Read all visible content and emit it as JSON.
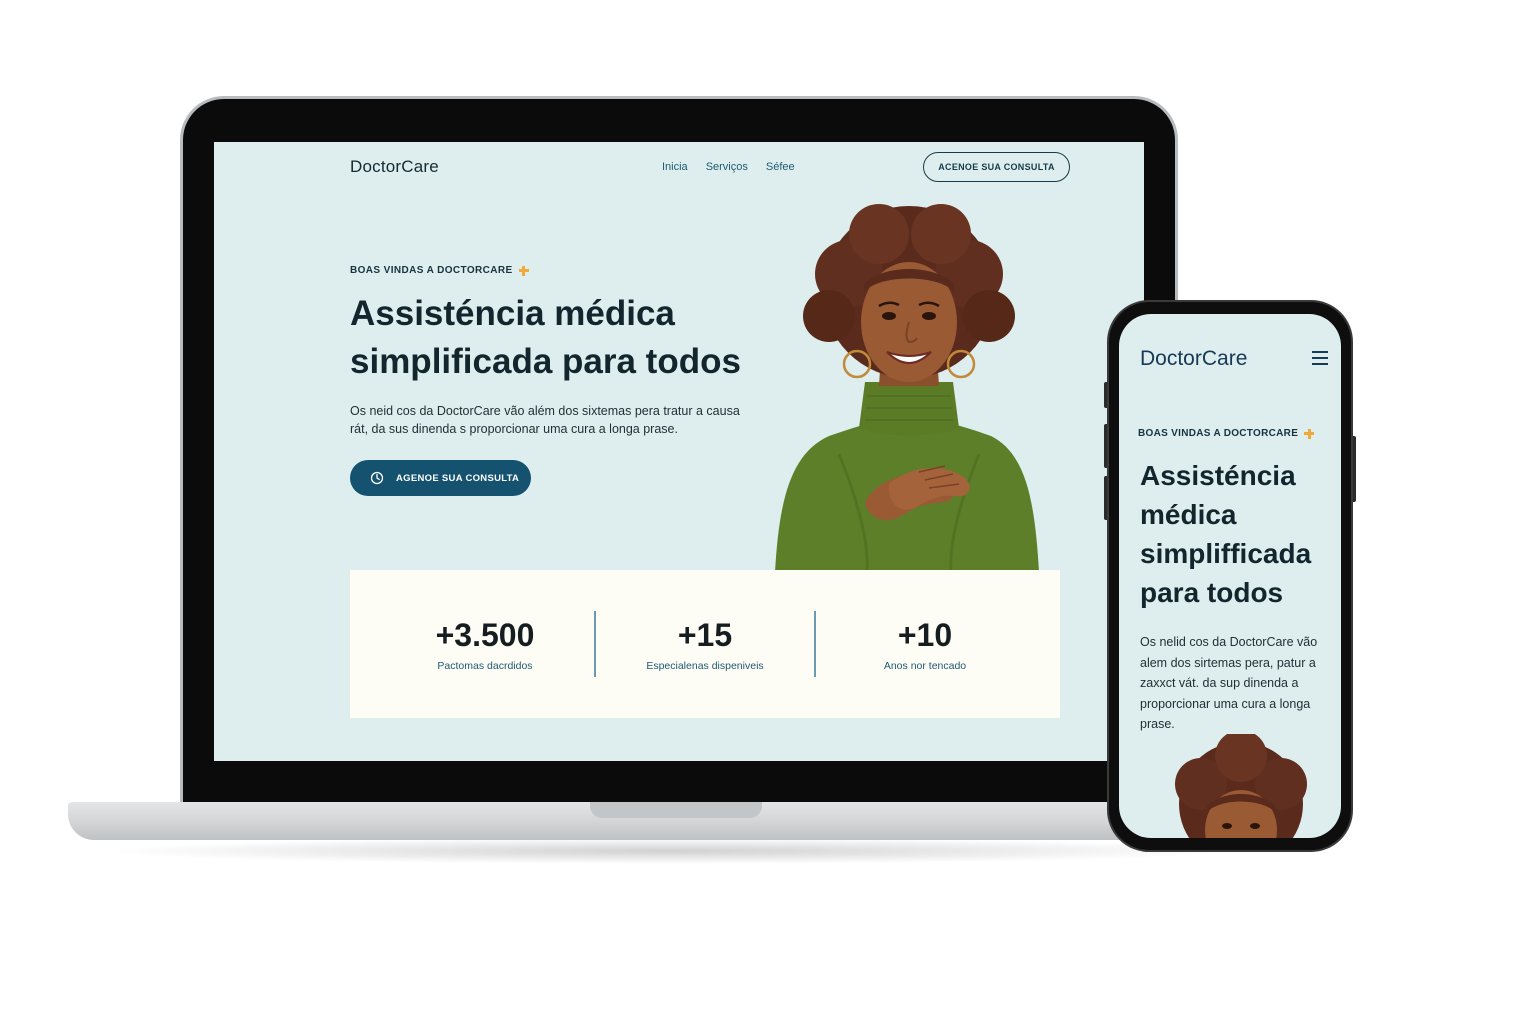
{
  "laptop": {
    "brand": "DoctorCare",
    "nav": {
      "links": [
        "Inicia",
        "Serviços",
        "Séfee"
      ],
      "cta_label": "ACENOE SUA CONSULTA"
    },
    "hero": {
      "eyebrow": "BOAS VINDAS A DOCTORCARE",
      "title": "Assisténcia médica simplificada para todos",
      "text": "Os neid cos da DoctorCare vão além dos sixtemas pera tratur a causa rát, da sus dinenda s proporcionar uma cura a longa prase.",
      "cta_label": "AGENOE SUA CONSULTA"
    },
    "stats": [
      {
        "value": "+3.500",
        "label": "Pactomas dacrdidos"
      },
      {
        "value": "+15",
        "label": "Especialenas dispeniveis"
      },
      {
        "value": "+10",
        "label": "Anos nor tencado"
      }
    ]
  },
  "phone": {
    "brand": "DoctorCare",
    "eyebrow": "BOAS VINDAS A DOCTORCARE",
    "title": "Assisténcia médica simplifficada para todos",
    "text": "Os nelid cos da DoctorCare vão alem dos sirtemas pera, patur a zaxxct vát. da sup dinenda a proporcionar uma cura a longa prase."
  },
  "colors": {
    "screen_bg": "#deeeee",
    "primary": "#145270",
    "accent_plus": "#f2a93b",
    "stats_bg": "#fdfcf5",
    "sweater": "#5e7f2a"
  },
  "icons": [
    "plus-icon",
    "calendar-icon",
    "menu-icon"
  ]
}
